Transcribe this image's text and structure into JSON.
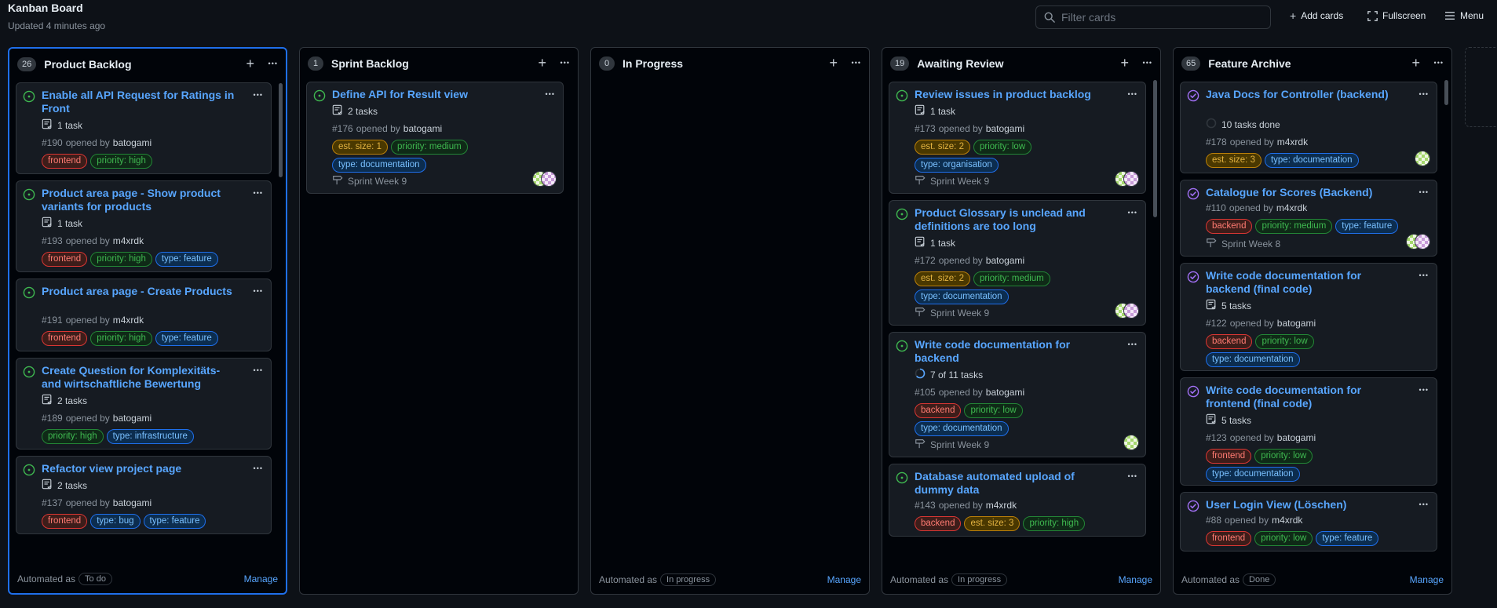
{
  "header": {
    "title": "Kanban Board",
    "updated": "Updated 4 minutes ago",
    "filter_placeholder": "Filter cards",
    "add_cards": "Add cards",
    "fullscreen": "Fullscreen",
    "menu": "Menu"
  },
  "colors": {
    "accent": "#58a6ff",
    "open_issue": "#3fb950",
    "closed_issue": "#a371f7",
    "selected_border": "#1f6feb"
  },
  "labels": {
    "frontend": {
      "text": "frontend",
      "bg": "#3d1d1a",
      "border": "#da3633",
      "color": "#ff7b72"
    },
    "backend": {
      "text": "backend",
      "bg": "#3d1d1a",
      "border": "#da3633",
      "color": "#ff7b72"
    },
    "priority_high": {
      "text": "priority: high",
      "bg": "#0f2a17",
      "border": "#238636",
      "color": "#3fb950"
    },
    "priority_medium": {
      "text": "priority: medium",
      "bg": "#0f2a17",
      "border": "#238636",
      "color": "#3fb950"
    },
    "priority_low": {
      "text": "priority: low",
      "bg": "#0f2a17",
      "border": "#238636",
      "color": "#3fb950"
    },
    "type_feature": {
      "text": "type: feature",
      "bg": "#0c2d4f",
      "border": "#1f6feb",
      "color": "#79c0ff"
    },
    "type_bug": {
      "text": "type: bug",
      "bg": "#0c2d4f",
      "border": "#1f6feb",
      "color": "#79c0ff"
    },
    "type_infrastructure": {
      "text": "type: infrastructure",
      "bg": "#0c2d4f",
      "border": "#1f6feb",
      "color": "#79c0ff"
    },
    "type_documentation": {
      "text": "type: documentation",
      "bg": "#0c2d4f",
      "border": "#1f6feb",
      "color": "#79c0ff"
    },
    "type_organisation": {
      "text": "type: organisation",
      "bg": "#0c2d4f",
      "border": "#1f6feb",
      "color": "#79c0ff"
    },
    "est_size_1": {
      "text": "est. size: 1",
      "bg": "#4a3800",
      "border": "#bb8009",
      "color": "#e3b341"
    },
    "est_size_2": {
      "text": "est. size: 2",
      "bg": "#4a3800",
      "border": "#bb8009",
      "color": "#e3b341"
    },
    "est_size_3": {
      "text": "est. size: 3",
      "bg": "#4a3800",
      "border": "#bb8009",
      "color": "#e3b341"
    }
  },
  "columns": [
    {
      "key": "product-backlog",
      "count": "26",
      "name": "Product Backlog",
      "selected": true,
      "automated_label": "Automated as",
      "automation": "To do",
      "manage": "Manage",
      "cards": [
        {
          "state": "open",
          "title": "Enable all API Request for Ratings in Front",
          "tasks": "1 task",
          "number": "#190",
          "opened_by": "opened by",
          "author": "batogami",
          "tags": [
            "frontend",
            "priority_high"
          ]
        },
        {
          "state": "open",
          "title": "Product area page - Show product variants for products",
          "tasks": "1 task",
          "number": "#193",
          "opened_by": "opened by",
          "author": "m4xrdk",
          "tags": [
            "frontend",
            "priority_high",
            "type_feature"
          ]
        },
        {
          "state": "open",
          "title": "Product area page - Create Products",
          "number": "#191",
          "opened_by": "opened by",
          "author": "m4xrdk",
          "tags": [
            "frontend",
            "priority_high",
            "type_feature"
          ]
        },
        {
          "state": "open",
          "title": "Create Question for Komplexitäts- and wirtschaftliche Bewertung",
          "tasks": "2 tasks",
          "number": "#189",
          "opened_by": "opened by",
          "author": "batogami",
          "tags": [
            "priority_high",
            "type_infrastructure"
          ]
        },
        {
          "state": "open",
          "title": "Refactor view project page",
          "tasks": "2 tasks",
          "number": "#137",
          "opened_by": "opened by",
          "author": "batogami",
          "tags": [
            "frontend",
            "type_bug",
            "type_feature"
          ]
        }
      ]
    },
    {
      "key": "sprint-backlog",
      "count": "1",
      "name": "Sprint Backlog",
      "cards": [
        {
          "state": "open",
          "title": "Define API for Result view",
          "tasks": "2 tasks",
          "number": "#176",
          "opened_by": "opened by",
          "author": "batogami",
          "tags": [
            "est_size_1",
            "priority_medium",
            "type_documentation"
          ],
          "milestone": "Sprint Week 9",
          "avatars": 2
        }
      ]
    },
    {
      "key": "in-progress",
      "count": "0",
      "name": "In Progress",
      "automated_label": "Automated as",
      "automation": "In progress",
      "manage": "Manage",
      "cards": []
    },
    {
      "key": "awaiting-review",
      "count": "19",
      "name": "Awaiting Review",
      "automated_label": "Automated as",
      "automation": "In progress",
      "manage": "Manage",
      "cards": [
        {
          "state": "open",
          "title": "Review issues in product backlog",
          "tasks": "1 task",
          "number": "#173",
          "opened_by": "opened by",
          "author": "batogami",
          "tags": [
            "est_size_2",
            "priority_low",
            "type_organisation"
          ],
          "milestone": "Sprint Week 9",
          "avatars": 2
        },
        {
          "state": "open",
          "title": "Product Glossary is unclead and definitions are too long",
          "tasks": "1 task",
          "number": "#172",
          "opened_by": "opened by",
          "author": "batogami",
          "tags": [
            "est_size_2",
            "priority_medium",
            "type_documentation"
          ],
          "milestone": "Sprint Week 9",
          "avatars": 2
        },
        {
          "state": "open",
          "title": "Write code documentation for backend",
          "progress": "7 of 11 tasks",
          "progress_value": 0.64,
          "number": "#105",
          "opened_by": "opened by",
          "author": "batogami",
          "tags": [
            "backend",
            "priority_low",
            "type_documentation"
          ],
          "milestone": "Sprint Week 9",
          "avatars": 1
        },
        {
          "state": "open",
          "title": "Database automated upload of dummy data",
          "number": "#143",
          "opened_by": "opened by",
          "author": "m4xrdk",
          "tags": [
            "backend",
            "est_size_3",
            "priority_high"
          ]
        }
      ]
    },
    {
      "key": "feature-archive",
      "count": "65",
      "name": "Feature Archive",
      "automated_label": "Automated as",
      "automation": "Done",
      "manage": "Manage",
      "cards": [
        {
          "state": "closed",
          "title": "Java Docs for Controller (backend)",
          "done": "10 tasks done",
          "number": "#178",
          "opened_by": "opened by",
          "author": "m4xrdk",
          "tags": [
            "est_size_3",
            "type_documentation"
          ],
          "avatars": 1
        },
        {
          "state": "closed",
          "title": "Catalogue for Scores (Backend)",
          "number": "#110",
          "opened_by": "opened by",
          "author": "m4xrdk",
          "tags": [
            "backend",
            "priority_medium",
            "type_feature"
          ],
          "milestone": "Sprint Week 8",
          "avatars": 2
        },
        {
          "state": "closed",
          "title": "Write code documentation for backend (final code)",
          "tasks": "5 tasks",
          "number": "#122",
          "opened_by": "opened by",
          "author": "batogami",
          "tags": [
            "backend",
            "priority_low",
            "type_documentation"
          ]
        },
        {
          "state": "closed",
          "title": "Write code documentation for frontend (final code)",
          "tasks": "5 tasks",
          "number": "#123",
          "opened_by": "opened by",
          "author": "batogami",
          "tags": [
            "frontend",
            "priority_low",
            "type_documentation"
          ]
        },
        {
          "state": "closed",
          "title": "User Login View (Löschen)",
          "number": "#88",
          "opened_by": "opened by",
          "author": "m4xrdk",
          "tags": [
            "frontend",
            "priority_low",
            "type_feature"
          ]
        }
      ]
    }
  ]
}
